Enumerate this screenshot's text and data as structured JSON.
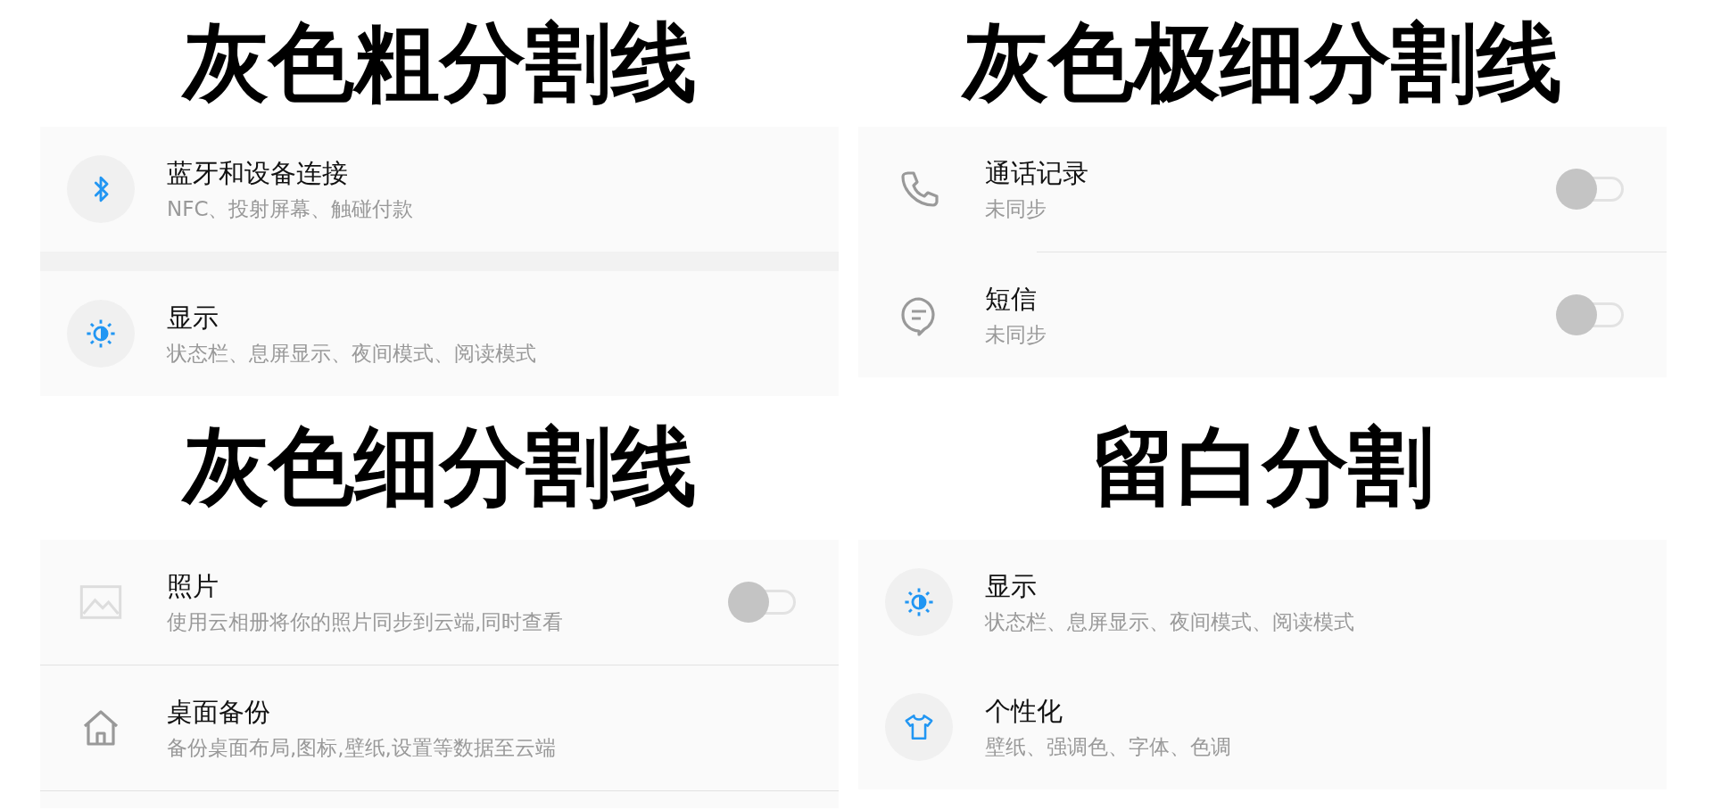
{
  "sections": [
    {
      "heading": "灰色粗分割线",
      "kind": "thick",
      "items": [
        {
          "kind": "bluetooth",
          "title": "蓝牙和设备连接",
          "subtitle": "NFC、投射屏幕、触碰付款"
        },
        {
          "kind": "brightness",
          "title": "显示",
          "subtitle": "状态栏、息屏显示、夜间模式、阅读模式"
        }
      ]
    },
    {
      "heading": "灰色极细分割线",
      "kind": "hairline",
      "items": [
        {
          "kind": "phone",
          "title": "通话记录",
          "subtitle": "未同步",
          "on": false
        },
        {
          "kind": "message",
          "title": "短信",
          "subtitle": "未同步",
          "on": false
        }
      ]
    },
    {
      "heading": "灰色细分割线",
      "kind": "thin",
      "items": [
        {
          "kind": "image",
          "title": "照片",
          "subtitle": "使用云相册将你的照片同步到云端,同时查看",
          "on": false
        },
        {
          "kind": "home",
          "title": "桌面备份",
          "subtitle": "备份桌面布局,图标,壁纸,设置等数据至云端"
        }
      ]
    },
    {
      "heading": "留白分割",
      "kind": "spacing",
      "items": [
        {
          "kind": "brightness",
          "title": "显示",
          "subtitle": "状态栏、息屏显示、夜间模式、阅读模式"
        },
        {
          "kind": "shirt",
          "title": "个性化",
          "subtitle": "壁纸、强调色、字体、色调"
        }
      ]
    }
  ]
}
